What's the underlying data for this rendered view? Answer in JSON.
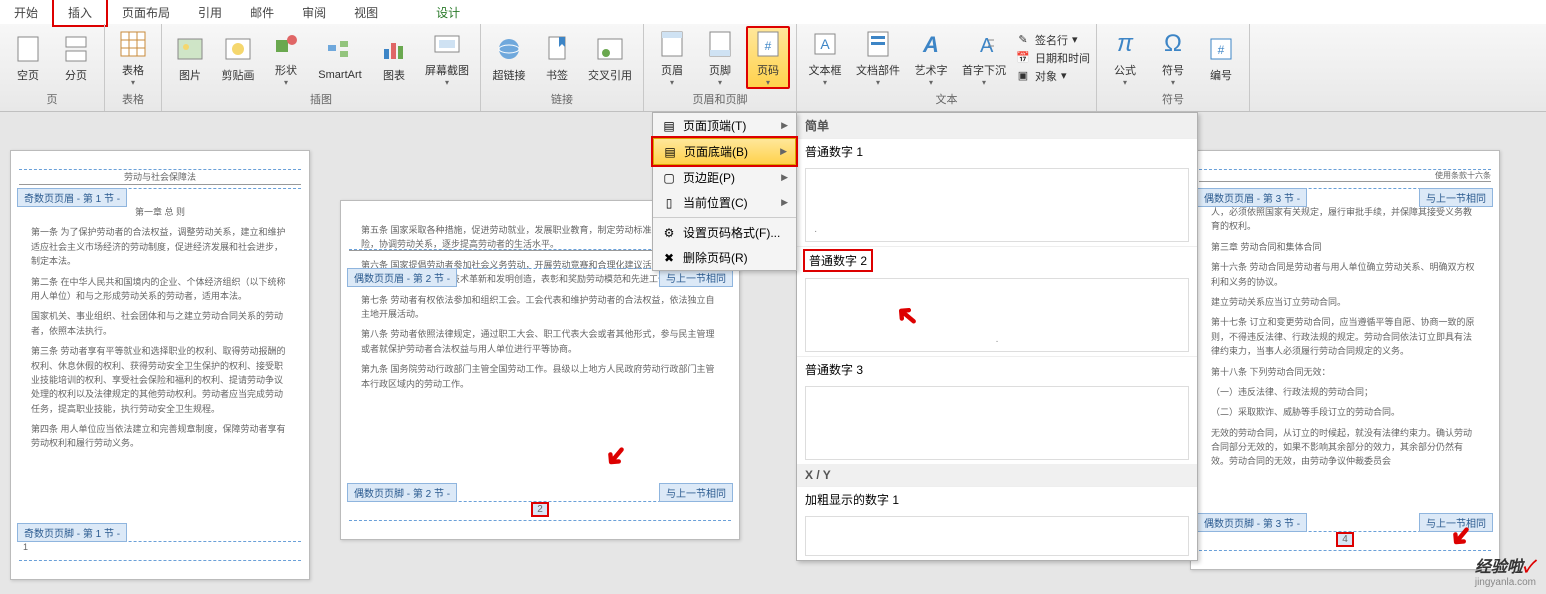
{
  "tabs": {
    "start": "开始",
    "insert": "插入",
    "layout": "页面布局",
    "ref": "引用",
    "mail": "邮件",
    "review": "审阅",
    "view": "视图",
    "design": "设计"
  },
  "ribbon": {
    "pages": {
      "blank": "空页",
      "break": "分页",
      "table": "表格",
      "label": "页",
      "tables_label": "表格"
    },
    "illust": {
      "pic": "图片",
      "clip": "剪贴画",
      "shape": "形状",
      "smart": "SmartArt",
      "chart": "图表",
      "screenshot": "屏幕截图",
      "label": "插图"
    },
    "links": {
      "hyper": "超链接",
      "bookmark": "书签",
      "xref": "交叉引用",
      "label": "链接"
    },
    "hf": {
      "header": "页眉",
      "footer": "页脚",
      "pagenum": "页码",
      "label": "页眉和页脚"
    },
    "text": {
      "textbox": "文本框",
      "parts": "文档部件",
      "wordart": "艺术字",
      "dropcap": "首字下沉",
      "sig": "签名行",
      "datetime": "日期和时间",
      "obj": "对象",
      "label": "文本"
    },
    "symbol": {
      "eq": "公式",
      "sym": "符号",
      "num": "编号",
      "label": "符号"
    }
  },
  "dropdown": {
    "top": "页面顶端(T)",
    "bottom": "页面底端(B)",
    "margin": "页边距(P)",
    "current": "当前位置(C)",
    "format": "设置页码格式(F)...",
    "remove": "删除页码(R)"
  },
  "submenu": {
    "simple": "简单",
    "plain1": "普通数字 1",
    "plain2": "普通数字 2",
    "plain3": "普通数字 3",
    "xy": "X / Y",
    "bold1": "加粗显示的数字 1"
  },
  "pages": {
    "p1": {
      "header_label": "奇数页页眉 - 第 1 节 -",
      "footer_label": "奇数页页脚 - 第 1 节 -",
      "header_text": "劳动与社会保障法",
      "t1": "第一章  总 则",
      "t2": "第一条  为了保护劳动者的合法权益，调整劳动关系，建立和维护适应社会主义市场经济的劳动制度，促进经济发展和社会进步，制定本法。",
      "t3": "第二条  在中华人民共和国境内的企业、个体经济组织（以下统称用人单位）和与之形成劳动关系的劳动者，适用本法。",
      "t4": "国家机关、事业组织、社会团体和与之建立劳动合同关系的劳动者，依照本法执行。",
      "t5": "第三条  劳动者享有平等就业和选择职业的权利、取得劳动报酬的权利、休息休假的权利、获得劳动安全卫生保护的权利、接受职业技能培训的权利、享受社会保险和福利的权利、提请劳动争议处理的权利以及法律规定的其他劳动权利。劳动者应当完成劳动任务，提高职业技能，执行劳动安全卫生规程。",
      "t6": "第四条  用人单位应当依法建立和完善规章制度，保障劳动者享有劳动权利和履行劳动义务。",
      "pn": "1"
    },
    "p2": {
      "header_label": "偶数页页眉 - 第 2 节 -",
      "footer_label": "偶数页页脚 - 第 2 节 -",
      "same": "与上一节相同",
      "t1": "第五条  国家采取各种措施，促进劳动就业，发展职业教育，制定劳动标准，调节社会保险，协调劳动关系，逐步提高劳动者的生活水平。",
      "t2": "第六条  国家提倡劳动者参加社会义务劳动，开展劳动竞赛和合理化建议活动，鼓励和保护劳动者进行科学研究、技术革新和发明创造，表彰和奖励劳动模范和先进工作者。",
      "t3": "第七条  劳动者有权依法参加和组织工会。工会代表和维护劳动者的合法权益，依法独立自主地开展活动。",
      "t4": "第八条  劳动者依照法律规定，通过职工大会、职工代表大会或者其他形式，参与民主管理或者就保护劳动者合法权益与用人单位进行平等协商。",
      "t5": "第九条  国务院劳动行政部门主管全国劳动工作。县级以上地方人民政府劳动行政部门主管本行政区域内的劳动工作。",
      "pn": "2"
    },
    "p3": {
      "header_label": "偶数页页眉 - 第 3 节 -",
      "footer_label": "偶数页页脚 - 第 3 节 -",
      "same": "与上一节相同",
      "header_text": "使用条款十六条",
      "t0": "人，必须依照国家有关规定，履行审批手续，并保障其接受义务教育的权利。",
      "t1": "第三章  劳动合同和集体合同",
      "t2": "第十六条  劳动合同是劳动者与用人单位确立劳动关系、明确双方权利和义务的协议。",
      "t2b": "建立劳动关系应当订立劳动合同。",
      "t3": "第十七条  订立和变更劳动合同，应当遵循平等自愿、协商一致的原则，不得违反法律、行政法规的规定。劳动合同依法订立即具有法律约束力，当事人必须履行劳动合同规定的义务。",
      "t4": "第十八条  下列劳动合同无效：",
      "t5": "（一）违反法律、行政法规的劳动合同；",
      "t6": "（二）采取欺诈、威胁等手段订立的劳动合同。",
      "t7": "无效的劳动合同，从订立的时候起，就没有法律约束力。确认劳动合同部分无效的，如果不影响其余部分的效力，其余部分仍然有效。劳动合同的无效，由劳动争议仲裁委员会",
      "pn": "4"
    }
  },
  "watermark": {
    "main": "经验啦",
    "sub": "jingyanla.com"
  }
}
